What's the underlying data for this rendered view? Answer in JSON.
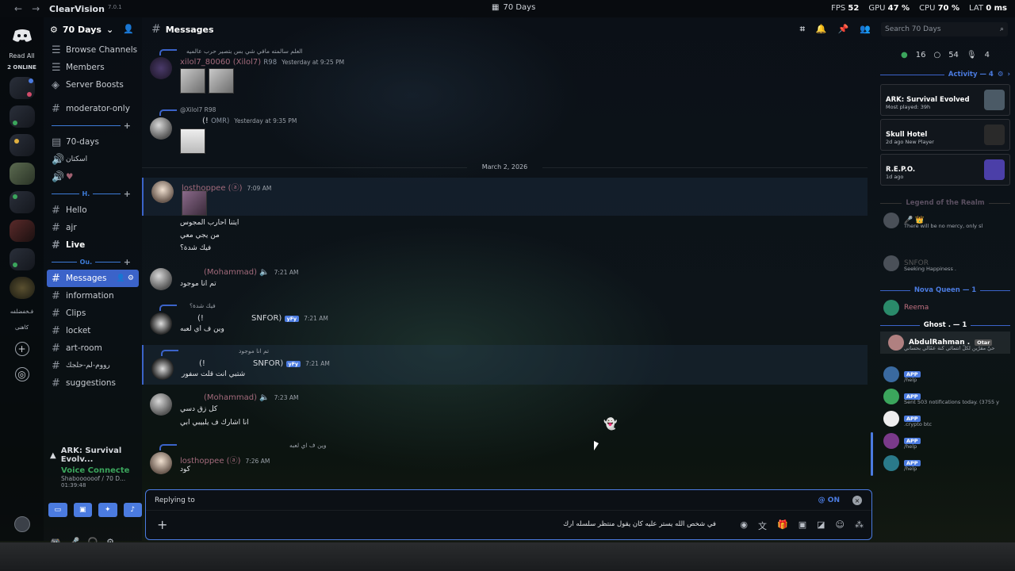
{
  "topbar": {
    "app_name": "ClearVision",
    "app_version": "7.0.1",
    "window_title": "70 Days",
    "fps_label": "FPS",
    "fps_value": "52",
    "gpu_label": "GPU",
    "gpu_value": "47 %",
    "cpu_label": "CPU",
    "cpu_value": "70 %",
    "lat_label": "LAT",
    "lat_value": "0 ms"
  },
  "rail": {
    "read_all": "Read All",
    "online": "2 ONLINE",
    "server_text": "فـخفضلفه",
    "server_text2": "كاهنى"
  },
  "guild": {
    "name": "70 Days",
    "top_items": [
      {
        "label": "Browse Channels",
        "icon": "browse-icon"
      },
      {
        "label": "Members",
        "icon": "members-icon"
      },
      {
        "label": "Server Boosts",
        "icon": "boost-icon"
      }
    ],
    "moderator": "moderator-only",
    "ch_70days": "70-days",
    "ch_voice1": "اسكتان",
    "category_h": "H.",
    "ch_hello": "Hello",
    "ch_ajr": "ajr",
    "ch_live": "Live",
    "category_ou": "Ou.",
    "ch_messages": "Messages",
    "ch_information": "information",
    "ch_clips": "Clips",
    "ch_locket": "locket",
    "ch_artroom": "art-room",
    "ch_arabic": "رووم-لم-حلجك",
    "ch_suggestions": "suggestions",
    "activity": "ARK: Survival Evolv...",
    "voice_title": "Voice Connecte",
    "voice_sub": "Shaboooooof / 70 D...",
    "voice_time": "01:39:48"
  },
  "chat": {
    "channel": "Messages",
    "search_placeholder": "Search 70 Days",
    "date_divider": "March 2, 2026",
    "messages": [
      {
        "reply": "العلم سالمته مافي شي بس بتصير حرب عالميه",
        "user": "xilol7_80060 (Xilol7)",
        "tag": "R98",
        "time": "Yesterday at 9:25 PM"
      },
      {
        "reply": "@Xilol7  R98",
        "user": "(!",
        "tag": "OMR)",
        "time": "Yesterday at 9:35 PM"
      },
      {
        "user": "losthoppee (ⓐ)",
        "time": "7:09 AM",
        "lines": [
          "ايتنا احارب المجوس",
          "من يجي معي",
          "فيك شدة؟"
        ]
      },
      {
        "user": "(Mohammad)",
        "time": "7:21 AM",
        "lines": [
          "تم انا موجود"
        ]
      },
      {
        "reply": "فيك شدة؟",
        "user": "(!",
        "tag": "SNFOR)",
        "badge": "yFy",
        "time": "7:21 AM",
        "lines": [
          "وين ف اي لعبه"
        ]
      },
      {
        "reply": "تم انا موجود",
        "user": "(!",
        "tag": "SNFOR)",
        "badge": "yFy",
        "time": "7:21 AM",
        "lines": [
          "شتبي انت قلت سفور"
        ]
      },
      {
        "user": "(Mohammad)",
        "time": "7:23 AM",
        "lines": [
          "كل زق دسي",
          "انا اشارك ف يلبيبي ابي"
        ]
      },
      {
        "reply": "وين ف اي لعبه",
        "user": "losthoppee (ⓐ)",
        "time": "7:26 AM",
        "lines": [
          "كود"
        ]
      }
    ],
    "reply_to": "Replying to",
    "mention": "@ ON",
    "input_text": "في شخص الله يستر عليه كان يقول منتظر سلسله ارك"
  },
  "right": {
    "online": "16",
    "idle": "54",
    "voice": "4",
    "activity_title": "Activity — 4",
    "games": [
      {
        "name": "ARK: Survival Evolved",
        "sub": "Most played: 39h",
        "color": "#4b5a66"
      },
      {
        "name": "Skull Hotel",
        "sub": "2d ago  New Player",
        "color": "#2a2a2a"
      },
      {
        "name": "R.E.P.O.",
        "sub": "1d ago",
        "color": "#4b3fa8"
      }
    ],
    "legend_title": "Legend of the Realm",
    "member1_sub": "There will be no mercy, only sl",
    "member2_sub": "Seeking Happiness .",
    "member2_tag": "SNFOR",
    "nova_title": "Nova Queen — 1",
    "nova_member": "Reema",
    "ghost_title": "Ghost . — 1",
    "ghost_member": "AbdulRahman .",
    "ghost_tag": "Otar",
    "ghost_sub": "حيّ مقرّين لكلّ انتمائي كنة عمّالي بحساني",
    "apps": [
      {
        "sub": "/help"
      },
      {
        "sub": "Sent 503 notifications today. (3755 y"
      },
      {
        "sub": ".crypto btc"
      },
      {
        "sub": "/help"
      },
      {
        "sub": "/help"
      }
    ],
    "app_badge": "APP"
  }
}
